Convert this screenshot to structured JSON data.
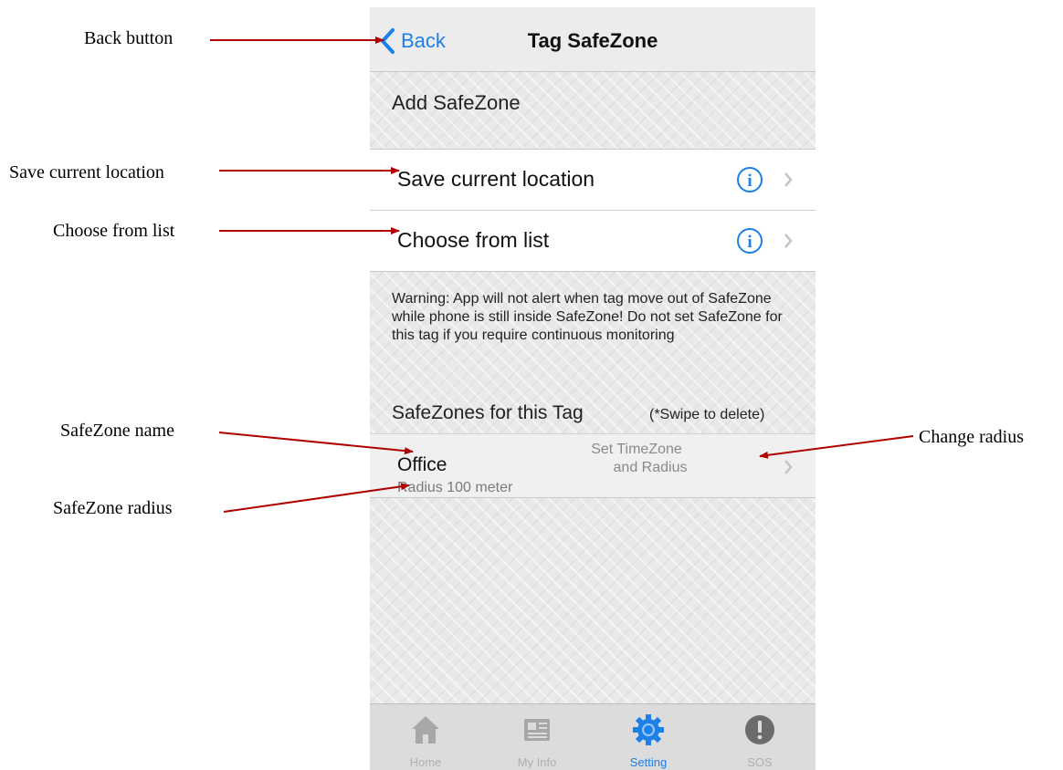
{
  "callouts": {
    "back_button": "Back button",
    "save_current_location": "Save current location",
    "choose_from_list": "Choose from list",
    "safezone_name": "SafeZone name",
    "safezone_radius": "SafeZone radius",
    "change_radius": "Change radius"
  },
  "navbar": {
    "back_label": "Back",
    "title": "Tag SafeZone"
  },
  "add_section": {
    "header": "Add SafeZone"
  },
  "rows": [
    {
      "label": "Save current location",
      "icon": "info-icon"
    },
    {
      "label": "Choose from list",
      "icon": "info-icon"
    }
  ],
  "warning": "Warning: App will not alert when tag move out of SafeZone while phone is still inside SafeZone! Do not set SafeZone for this tag if you require continuous monitoring",
  "safezones": {
    "header": "SafeZones for this Tag",
    "hint": "(*Swipe to delete)",
    "items": [
      {
        "name": "Office",
        "radius": "Radius 100 meter",
        "action_line1": "Set TimeZone",
        "action_line2": "and Radius"
      }
    ]
  },
  "tabbar": {
    "tabs": [
      {
        "label": "Home",
        "icon": "home-icon"
      },
      {
        "label": "My Info",
        "icon": "newspaper-icon"
      },
      {
        "label": "Setting",
        "icon": "gear-icon",
        "active": true
      },
      {
        "label": "SOS",
        "icon": "alert-icon"
      }
    ]
  },
  "colors": {
    "accent": "#1d7fe8",
    "arrow": "#b00000"
  }
}
